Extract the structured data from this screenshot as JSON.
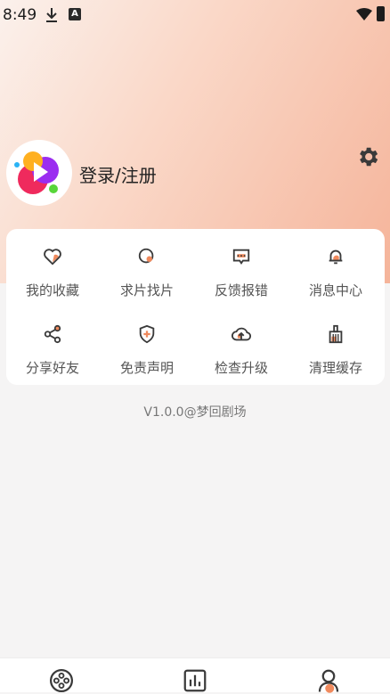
{
  "status_bar": {
    "time": "8:49",
    "notification_a": "A",
    "icons": [
      "download-icon",
      "a-notification-icon",
      "wifi-icon",
      "battery-icon"
    ]
  },
  "profile": {
    "login_label": "登录/注册",
    "avatar_icon": "app-logo-icon",
    "settings_icon": "gear-icon"
  },
  "menu": [
    {
      "label": "我的收藏",
      "icon": "heart-icon"
    },
    {
      "label": "求片找片",
      "icon": "search-film-icon"
    },
    {
      "label": "反馈报错",
      "icon": "feedback-icon"
    },
    {
      "label": "消息中心",
      "icon": "bell-icon"
    },
    {
      "label": "分享好友",
      "icon": "share-icon"
    },
    {
      "label": "免责声明",
      "icon": "shield-icon"
    },
    {
      "label": "检查升级",
      "icon": "cloud-upload-icon"
    },
    {
      "label": "清理缓存",
      "icon": "broom-icon"
    }
  ],
  "version": "V1.0.0@梦回剧场",
  "bottom_nav": [
    {
      "icon": "film-reel-icon",
      "active": false
    },
    {
      "icon": "chart-icon",
      "active": false
    },
    {
      "icon": "profile-icon",
      "active": true
    }
  ],
  "colors": {
    "accent": "#f08a5d",
    "icon_stroke": "#3a3a3a"
  }
}
